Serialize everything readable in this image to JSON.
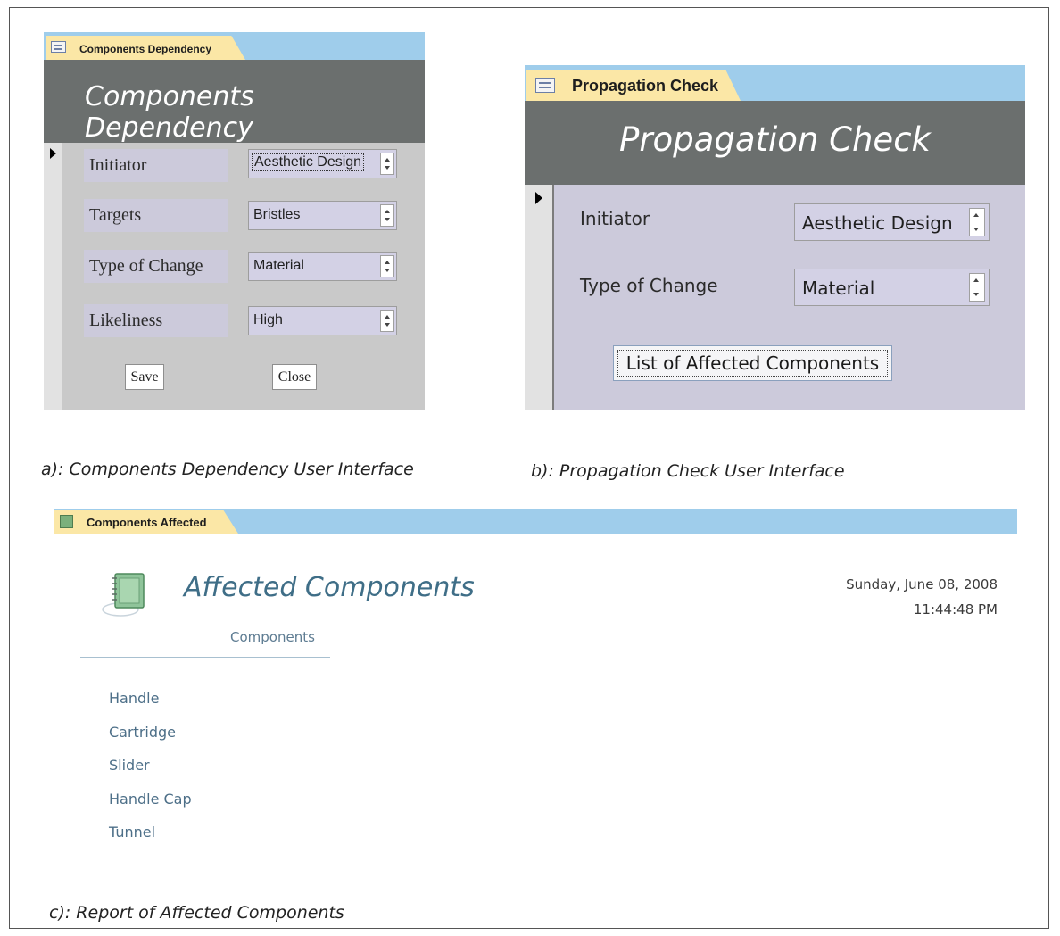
{
  "panel_a": {
    "tab_label": "Components Dependency",
    "header_title": "Components Dependency",
    "fields": [
      {
        "label": "Initiator",
        "value": "Aesthetic Design"
      },
      {
        "label": "Targets",
        "value": "Bristles"
      },
      {
        "label": "Type of Change",
        "value": "Material"
      },
      {
        "label": "Likeliness",
        "value": "High"
      }
    ],
    "save_label": "Save",
    "close_label": "Close"
  },
  "panel_b": {
    "tab_label": "Propagation Check",
    "header_title": "Propagation Check",
    "fields": [
      {
        "label": "Initiator",
        "value": "Aesthetic Design"
      },
      {
        "label": "Type of Change",
        "value": "Material"
      }
    ],
    "list_button_label": "List of Affected Components"
  },
  "captions": {
    "a": "a): Components Dependency User Interface",
    "b": "b): Propagation Check User Interface",
    "c": "c): Report of Affected Components"
  },
  "panel_c": {
    "tab_label": "Components Affected",
    "title": "Affected Components",
    "date": "Sunday, June 08, 2008",
    "time": "11:44:48 PM",
    "column_header": "Components",
    "items": [
      "Handle",
      "Cartridge",
      "Slider",
      "Handle Cap",
      "Tunnel"
    ]
  },
  "colors": {
    "tab_bar": "#9fcdeb",
    "tab_active": "#fbe7a6",
    "header": "#6b6f6e",
    "form_body": "#cccadb",
    "report_text": "#4d6f88"
  }
}
